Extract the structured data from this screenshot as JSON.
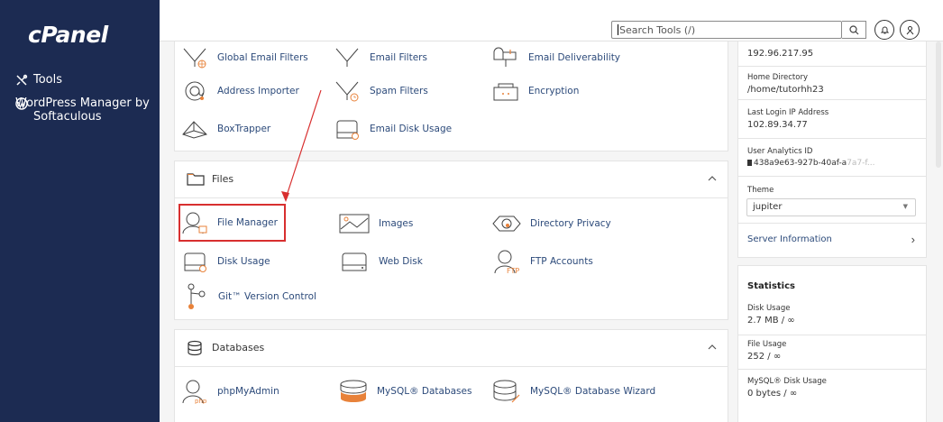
{
  "brand": {
    "logo_text": "cPanel"
  },
  "sidebar": {
    "items": [
      {
        "label": "Tools",
        "icon": "tools-icon"
      },
      {
        "label": "WordPress Manager by Softaculous",
        "icon": "wordpress-icon"
      }
    ]
  },
  "header": {
    "search_placeholder": "Search Tools (/)",
    "search_icon": "search-icon",
    "notifications_icon": "bell-icon",
    "user_icon": "user-icon"
  },
  "email_section": {
    "items": [
      {
        "label": "Global Email Filters"
      },
      {
        "label": "Email Filters"
      },
      {
        "label": "Email Deliverability"
      },
      {
        "label": "Address Importer"
      },
      {
        "label": "Spam Filters"
      },
      {
        "label": "Encryption"
      },
      {
        "label": "BoxTrapper"
      },
      {
        "label": "Email Disk Usage"
      }
    ]
  },
  "files_section": {
    "title": "Files",
    "items": [
      {
        "label": "File Manager"
      },
      {
        "label": "Images"
      },
      {
        "label": "Directory Privacy"
      },
      {
        "label": "Disk Usage"
      },
      {
        "label": "Web Disk"
      },
      {
        "label": "FTP Accounts"
      },
      {
        "label": "Git™ Version Control"
      }
    ]
  },
  "databases_section": {
    "title": "Databases",
    "items": [
      {
        "label": "phpMyAdmin"
      },
      {
        "label": "MySQL® Databases"
      },
      {
        "label": "MySQL® Database Wizard"
      }
    ]
  },
  "general_info": {
    "ip_value": "192.96.217.95",
    "home_dir_label": "Home Directory",
    "home_dir_value": "/home/tutorhh23",
    "last_login_label": "Last Login IP Address",
    "last_login_value": "102.89.34.77",
    "analytics_label": "User Analytics ID",
    "analytics_value": "438a9e63-927b-40af-a",
    "analytics_faded": "7a7-f...",
    "theme_label": "Theme",
    "theme_value": "jupiter",
    "server_info_label": "Server Information"
  },
  "statistics": {
    "title": "Statistics",
    "rows": [
      {
        "label": "Disk Usage",
        "value": "2.7 MB / ∞"
      },
      {
        "label": "File Usage",
        "value": "252 / ∞"
      },
      {
        "label": "MySQL® Disk Usage",
        "value": "0 bytes / ∞"
      }
    ]
  },
  "colors": {
    "sidebar": "#1c2b52",
    "link": "#2c4a7a",
    "highlight": "#d82f2f"
  }
}
